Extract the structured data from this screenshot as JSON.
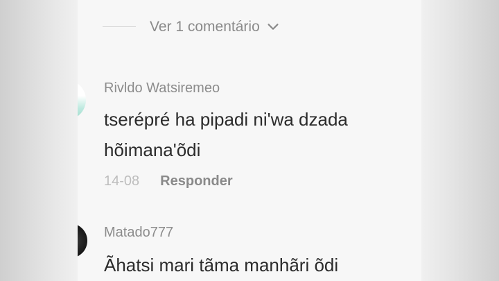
{
  "replies": {
    "view_label": "Ver 1 comentário",
    "icon": "chevron-down-icon"
  },
  "comments": [
    {
      "username": "Rivldo Watsiremeo",
      "text": "tserépré ha pipadi ni'wa dzada hõimana'õdi",
      "date": "14-08",
      "reply_label": "Responder"
    },
    {
      "username": "Matado777",
      "text": "Ãhatsi mari tãma manhãri õdi"
    }
  ],
  "colors": {
    "text_primary": "#2b2b2b",
    "text_secondary": "#8c8c8c",
    "date": "#bdbdbd",
    "background": "#f7f7f7"
  }
}
